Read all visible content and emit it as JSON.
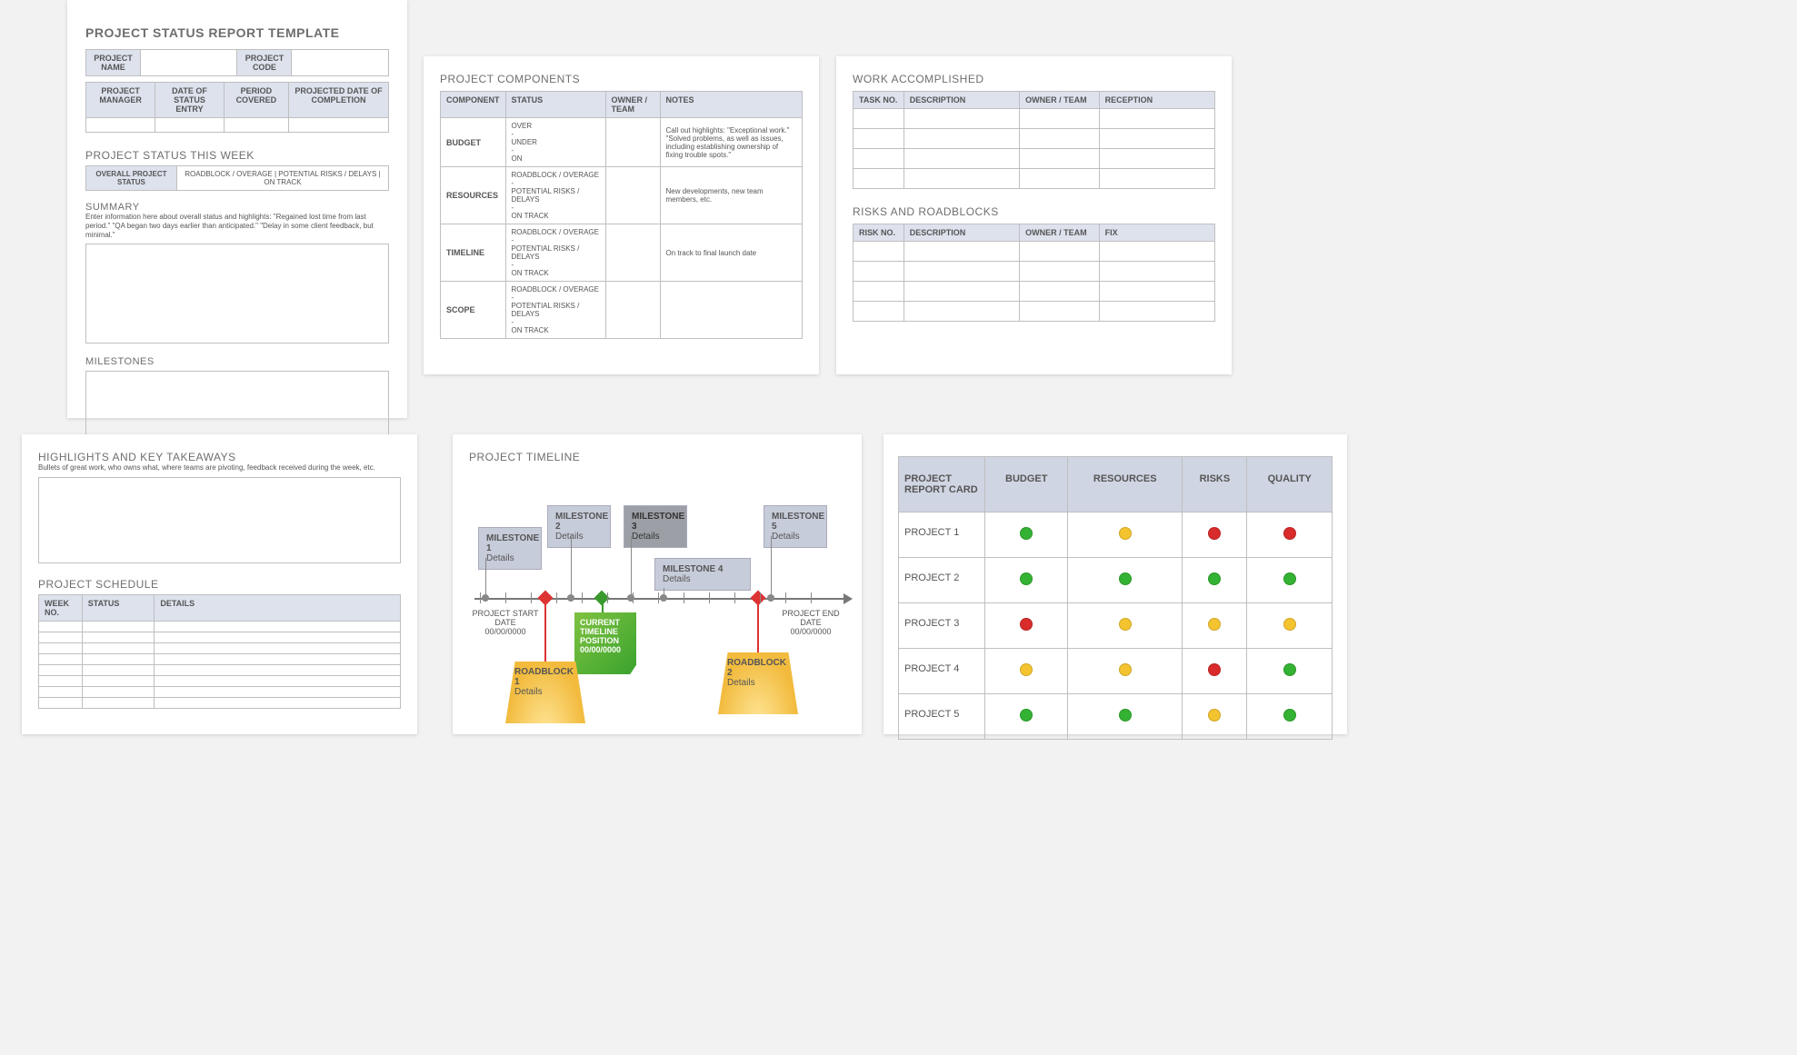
{
  "page1": {
    "title": "PROJECT STATUS REPORT TEMPLATE",
    "row1": {
      "project_name": "PROJECT NAME",
      "project_code": "PROJECT CODE"
    },
    "row2": {
      "project_manager": "PROJECT MANAGER",
      "date_of_status_entry": "DATE OF STATUS ENTRY",
      "period_covered": "PERIOD COVERED",
      "projected_date_of_completion": "PROJECTED DATE OF COMPLETION"
    },
    "status_this_week": "PROJECT STATUS THIS WEEK",
    "status_bar": {
      "overall": "OVERALL PROJECT STATUS",
      "opt1": "ROADBLOCK / OVERAGE",
      "opt2": "POTENTIAL RISKS / DELAYS",
      "opt3": "ON TRACK",
      "sep": " | "
    },
    "summary_label": "SUMMARY",
    "summary_hint": "Enter information here about overall status and highlights: \"Regained lost time from last period.\" \"QA began two days earlier than anticipated.\" \"Delay in some client feedback, but minimal.\"",
    "milestones_label": "MILESTONES"
  },
  "page2": {
    "title": "PROJECT COMPONENTS",
    "headers": {
      "component": "COMPONENT",
      "status": "STATUS",
      "owner": "OWNER / TEAM",
      "notes": "NOTES"
    },
    "rows": [
      {
        "component": "BUDGET",
        "status": "OVER\n-\nUNDER\n-\nON",
        "notes": "Call out highlights: \"Exceptional work.\" \"Solved problems, as well as issues, including establishing ownership of fixing trouble spots.\""
      },
      {
        "component": "RESOURCES",
        "status": "ROADBLOCK / OVERAGE\n-\nPOTENTIAL RISKS / DELAYS\n-\nON TRACK",
        "notes": "New developments, new team members, etc."
      },
      {
        "component": "TIMELINE",
        "status": "ROADBLOCK / OVERAGE\n-\nPOTENTIAL RISKS / DELAYS\n-\nON TRACK",
        "notes": "On track to final launch date"
      },
      {
        "component": "SCOPE",
        "status": "ROADBLOCK / OVERAGE\n-\nPOTENTIAL RISKS / DELAYS\n-\nON TRACK",
        "notes": ""
      }
    ]
  },
  "page3": {
    "work_title": "WORK ACCOMPLISHED",
    "work_headers": {
      "task_no": "TASK NO.",
      "description": "DESCRIPTION",
      "owner": "OWNER / TEAM",
      "reception": "RECEPTION"
    },
    "risk_title": "RISKS AND ROADBLOCKS",
    "risk_headers": {
      "risk_no": "RISK NO.",
      "description": "DESCRIPTION",
      "owner": "OWNER / TEAM",
      "fix": "FIX"
    }
  },
  "page4": {
    "highlights_title": "HIGHLIGHTS AND KEY TAKEAWAYS",
    "highlights_hint": "Bullets of great work, who owns what, where teams are pivoting, feedback received during the week, etc.",
    "schedule_title": "PROJECT SCHEDULE",
    "schedule_headers": {
      "week_no": "WEEK NO.",
      "status": "STATUS",
      "details": "DETAILS"
    }
  },
  "page5": {
    "title": "PROJECT TIMELINE",
    "start_label": "PROJECT START DATE",
    "start_date": "00/00/0000",
    "end_label": "PROJECT END DATE",
    "end_date": "00/00/0000",
    "milestones": [
      {
        "title": "MILESTONE 1",
        "sub": "Details"
      },
      {
        "title": "MILESTONE 2",
        "sub": "Details"
      },
      {
        "title": "MILESTONE 3",
        "sub": "Details"
      },
      {
        "title": "MILESTONE 4",
        "sub": "Details"
      },
      {
        "title": "MILESTONE 5",
        "sub": "Details"
      }
    ],
    "current_label": "CURRENT TIMELINE POSITION",
    "current_date": "00/00/0000",
    "roadblocks": [
      {
        "title": "ROADBLOCK 1",
        "sub": "Details"
      },
      {
        "title": "ROADBLOCK 2",
        "sub": "Details"
      }
    ]
  },
  "page6": {
    "header": {
      "left": "PROJECT REPORT CARD",
      "budget": "BUDGET",
      "resources": "RESOURCES",
      "risks": "RISKS",
      "quality": "QUALITY"
    },
    "rows": [
      {
        "name": "PROJECT 1",
        "cells": [
          "g",
          "y",
          "r",
          "r"
        ]
      },
      {
        "name": "PROJECT 2",
        "cells": [
          "g",
          "g",
          "g",
          "g"
        ]
      },
      {
        "name": "PROJECT 3",
        "cells": [
          "r",
          "y",
          "y",
          "y"
        ]
      },
      {
        "name": "PROJECT 4",
        "cells": [
          "y",
          "y",
          "r",
          "g"
        ]
      },
      {
        "name": "PROJECT 5",
        "cells": [
          "g",
          "g",
          "y",
          "g"
        ]
      }
    ]
  }
}
